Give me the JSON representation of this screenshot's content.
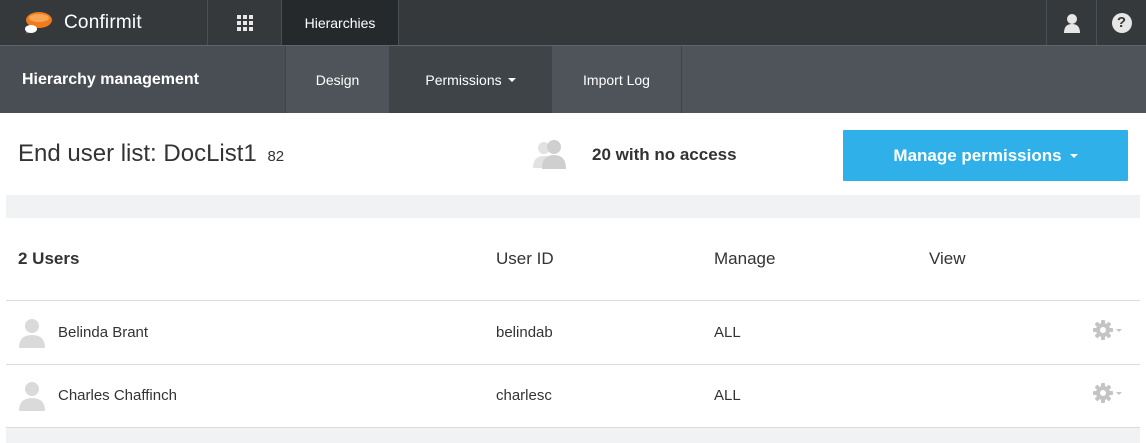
{
  "app": {
    "logo_text": "Confirmit",
    "active_tab": "Hierarchies"
  },
  "subnav": {
    "title": "Hierarchy management",
    "items": [
      {
        "label": "Design"
      },
      {
        "label": "Permissions"
      },
      {
        "label": "Import Log"
      }
    ]
  },
  "page": {
    "title": "End user list: DocList1",
    "count": "82",
    "no_access_text": "20 with no access",
    "manage_button": "Manage permissions"
  },
  "table": {
    "headers": {
      "users": "2 Users",
      "user_id": "User ID",
      "manage": "Manage",
      "view": "View"
    },
    "rows": [
      {
        "name": "Belinda Brant",
        "user_id": "belindab",
        "manage": "ALL",
        "view": ""
      },
      {
        "name": "Charles Chaffinch",
        "user_id": "charlesc",
        "manage": "ALL",
        "view": ""
      }
    ]
  },
  "colors": {
    "topbar": "#35393c",
    "subnav": "#4e5459",
    "accent": "#2fb0e8",
    "logo_orange": "#f07b1d"
  },
  "icons": {
    "logo": "confirmit-bubble-icon",
    "apps": "apps-grid-icon",
    "user": "user-icon",
    "help": "help-icon",
    "no_access": "user-group-icon",
    "avatar": "avatar-icon",
    "row_menu": "gear-icon"
  }
}
